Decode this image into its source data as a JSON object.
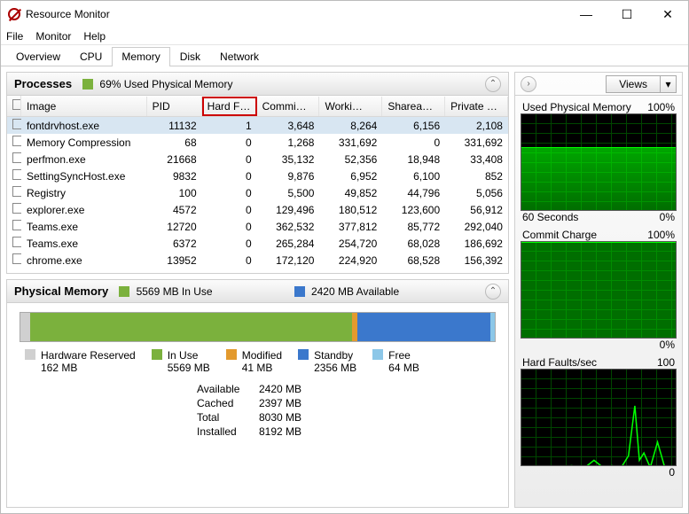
{
  "window": {
    "title": "Resource Monitor"
  },
  "menu": {
    "file": "File",
    "monitor": "Monitor",
    "help": "Help"
  },
  "tabs": {
    "overview": "Overview",
    "cpu": "CPU",
    "memory": "Memory",
    "disk": "Disk",
    "network": "Network"
  },
  "processes": {
    "title": "Processes",
    "summary": "69% Used Physical Memory",
    "columns": {
      "image": "Image",
      "pid": "PID",
      "hardf": "Hard F…",
      "commit": "Commi…",
      "working": "Worki…",
      "share": "Sharea…",
      "private": "Private …"
    },
    "rows": [
      {
        "image": "fontdrvhost.exe",
        "pid": "11132",
        "hardf": "1",
        "commit": "3,648",
        "working": "8,264",
        "share": "6,156",
        "private": "2,108",
        "sel": true
      },
      {
        "image": "Memory Compression",
        "pid": "68",
        "hardf": "0",
        "commit": "1,268",
        "working": "331,692",
        "share": "0",
        "private": "331,692"
      },
      {
        "image": "perfmon.exe",
        "pid": "21668",
        "hardf": "0",
        "commit": "35,132",
        "working": "52,356",
        "share": "18,948",
        "private": "33,408"
      },
      {
        "image": "SettingSyncHost.exe",
        "pid": "9832",
        "hardf": "0",
        "commit": "9,876",
        "working": "6,952",
        "share": "6,100",
        "private": "852"
      },
      {
        "image": "Registry",
        "pid": "100",
        "hardf": "0",
        "commit": "5,500",
        "working": "49,852",
        "share": "44,796",
        "private": "5,056"
      },
      {
        "image": "explorer.exe",
        "pid": "4572",
        "hardf": "0",
        "commit": "129,496",
        "working": "180,512",
        "share": "123,600",
        "private": "56,912"
      },
      {
        "image": "Teams.exe",
        "pid": "12720",
        "hardf": "0",
        "commit": "362,532",
        "working": "377,812",
        "share": "85,772",
        "private": "292,040"
      },
      {
        "image": "Teams.exe",
        "pid": "6372",
        "hardf": "0",
        "commit": "265,284",
        "working": "254,720",
        "share": "68,028",
        "private": "186,692"
      },
      {
        "image": "chrome.exe",
        "pid": "13952",
        "hardf": "0",
        "commit": "172,120",
        "working": "224,920",
        "share": "68,528",
        "private": "156,392"
      }
    ]
  },
  "physmem": {
    "title": "Physical Memory",
    "inuse_summary": "5569 MB In Use",
    "avail_summary": "2420 MB Available",
    "legend": {
      "hw": {
        "label": "Hardware Reserved",
        "val": "162 MB"
      },
      "inuse": {
        "label": "In Use",
        "val": "5569 MB"
      },
      "mod": {
        "label": "Modified",
        "val": "41 MB"
      },
      "standby": {
        "label": "Standby",
        "val": "2356 MB"
      },
      "free": {
        "label": "Free",
        "val": "64 MB"
      }
    },
    "stats": {
      "available_l": "Available",
      "available_v": "2420 MB",
      "cached_l": "Cached",
      "cached_v": "2397 MB",
      "total_l": "Total",
      "total_v": "8030 MB",
      "installed_l": "Installed",
      "installed_v": "8192 MB"
    }
  },
  "right": {
    "views": "Views",
    "g1": {
      "title": "Used Physical Memory",
      "max": "100%",
      "xlabel": "60 Seconds",
      "min": "0%"
    },
    "g2": {
      "title": "Commit Charge",
      "max": "100%",
      "min": "0%"
    },
    "g3": {
      "title": "Hard Faults/sec",
      "max": "100",
      "min": "0"
    }
  }
}
